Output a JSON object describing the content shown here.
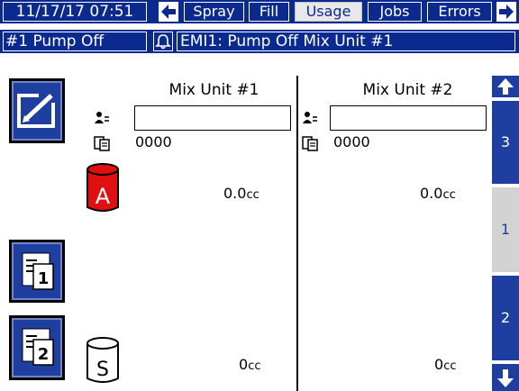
{
  "topbar": {
    "datetime": "11/17/17 07:51",
    "tabs": [
      "Spray",
      "Fill",
      "Usage",
      "Jobs",
      "Errors"
    ],
    "active_tab": "Usage",
    "prev_icon": "arrow-left-icon",
    "next_icon": "arrow-right-icon"
  },
  "statusbar": {
    "pump_status": "#1 Pump Off",
    "alarm_icon": "bell-icon",
    "message": "EMI1: Pump Off Mix Unit #1"
  },
  "units": [
    {
      "title": "Mix Unit #1",
      "user_id": "",
      "job": "0000",
      "a_volume": "0.0",
      "a_unit": "cc",
      "solvent_volume": "0",
      "solvent_unit": "cc"
    },
    {
      "title": "Mix Unit #2",
      "user_id": "",
      "job": "0000",
      "a_volume": "0.0",
      "a_unit": "cc",
      "solvent_volume": "0",
      "solvent_unit": "cc"
    }
  ],
  "component_labels": {
    "a": "A",
    "solvent": "S"
  },
  "right_nav": {
    "up_icon": "arrow-up-icon",
    "down_icon": "arrow-down-icon",
    "pages": [
      "3",
      "1",
      "2"
    ],
    "active_page": "1"
  },
  "colors": {
    "header_blue": "#0b2a8f",
    "button_blue": "#1e3fa0",
    "component_a_red": "#e01010"
  }
}
